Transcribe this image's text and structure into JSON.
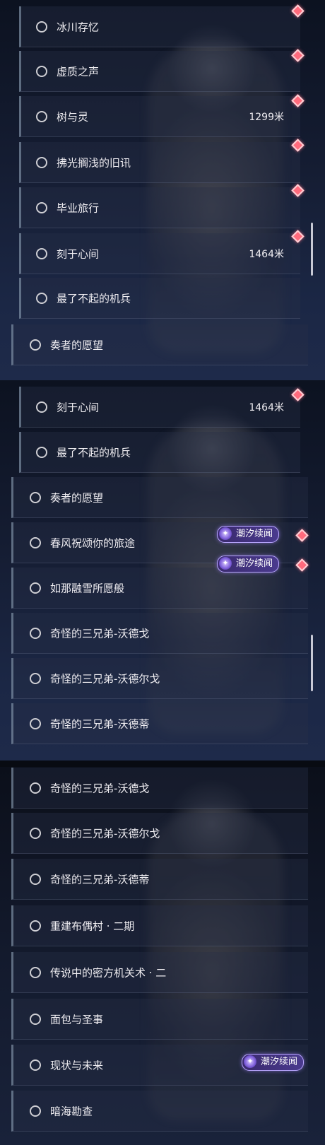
{
  "icons": {
    "radio": "radio-circle-icon",
    "new_marker": "red-diamond-icon",
    "badge_icon": "tidal-chronicle-icon"
  },
  "colors": {
    "marker": "#ff6a7c",
    "badge_border": "#b9a6ff",
    "row_accent": "#96aabe"
  },
  "panels": [
    {
      "rows": [
        {
          "label": "冰川存忆",
          "dist": ""
        },
        {
          "label": "虚质之声",
          "dist": ""
        },
        {
          "label": "树与灵",
          "dist": "1299米"
        },
        {
          "label": "拂光搁浅的旧讯",
          "dist": ""
        },
        {
          "label": "毕业旅行",
          "dist": ""
        },
        {
          "label": "刻于心间",
          "dist": "1464米"
        },
        {
          "label": "最了不起的机兵",
          "dist": ""
        },
        {
          "label": "奏者的愿望",
          "dist": ""
        }
      ]
    },
    {
      "rows": [
        {
          "label": "刻于心间",
          "dist": "1464米"
        },
        {
          "label": "最了不起的机兵",
          "dist": ""
        },
        {
          "label": "奏者的愿望",
          "dist": ""
        },
        {
          "label": "春风祝颂你的旅途",
          "badge": "潮汐续闻"
        },
        {
          "label": "如那融雪所愿般",
          "badge": "潮汐续闻"
        },
        {
          "label": "奇怪的三兄弟-沃德戈"
        },
        {
          "label": "奇怪的三兄弟-沃德尔戈"
        },
        {
          "label": "奇怪的三兄弟-沃德蒂"
        }
      ]
    },
    {
      "rows": [
        {
          "label": "奇怪的三兄弟-沃德戈"
        },
        {
          "label": "奇怪的三兄弟-沃德尔戈"
        },
        {
          "label": "奇怪的三兄弟-沃德蒂"
        },
        {
          "label": "重建布偶村 · 二期"
        },
        {
          "label": "传说中的密方机关术 · 二"
        },
        {
          "label": "面包与圣事"
        },
        {
          "label": "现状与未来",
          "badge": "潮汐续闻"
        },
        {
          "label": "暗海勘查"
        }
      ]
    }
  ]
}
